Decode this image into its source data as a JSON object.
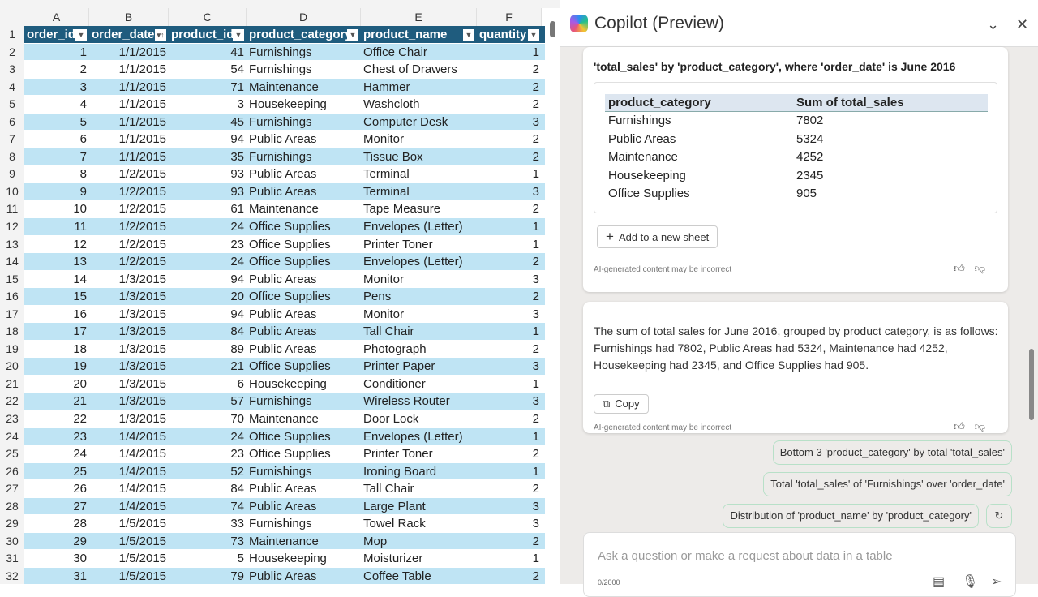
{
  "sheet": {
    "columns": [
      "A",
      "B",
      "C",
      "D",
      "E",
      "F"
    ],
    "headers": [
      "order_id",
      "order_date",
      "product_id",
      "product_category",
      "product_name",
      "quantity"
    ],
    "rows": [
      [
        1,
        "1/1/2015",
        41,
        "Furnishings",
        "Office Chair",
        1
      ],
      [
        2,
        "1/1/2015",
        54,
        "Furnishings",
        "Chest of Drawers",
        2
      ],
      [
        3,
        "1/1/2015",
        71,
        "Maintenance",
        "Hammer",
        2
      ],
      [
        4,
        "1/1/2015",
        3,
        "Housekeeping",
        "Washcloth",
        2
      ],
      [
        5,
        "1/1/2015",
        45,
        "Furnishings",
        "Computer Desk",
        3
      ],
      [
        6,
        "1/1/2015",
        94,
        "Public Areas",
        "Monitor",
        2
      ],
      [
        7,
        "1/1/2015",
        35,
        "Furnishings",
        "Tissue Box",
        2
      ],
      [
        8,
        "1/2/2015",
        93,
        "Public Areas",
        "Terminal",
        1
      ],
      [
        9,
        "1/2/2015",
        93,
        "Public Areas",
        "Terminal",
        3
      ],
      [
        10,
        "1/2/2015",
        61,
        "Maintenance",
        "Tape Measure",
        2
      ],
      [
        11,
        "1/2/2015",
        24,
        "Office Supplies",
        "Envelopes (Letter)",
        1
      ],
      [
        12,
        "1/2/2015",
        23,
        "Office Supplies",
        "Printer Toner",
        1
      ],
      [
        13,
        "1/2/2015",
        24,
        "Office Supplies",
        "Envelopes (Letter)",
        2
      ],
      [
        14,
        "1/3/2015",
        94,
        "Public Areas",
        "Monitor",
        3
      ],
      [
        15,
        "1/3/2015",
        20,
        "Office Supplies",
        "Pens",
        2
      ],
      [
        16,
        "1/3/2015",
        94,
        "Public Areas",
        "Monitor",
        3
      ],
      [
        17,
        "1/3/2015",
        84,
        "Public Areas",
        "Tall Chair",
        1
      ],
      [
        18,
        "1/3/2015",
        89,
        "Public Areas",
        "Photograph",
        2
      ],
      [
        19,
        "1/3/2015",
        21,
        "Office Supplies",
        "Printer Paper",
        3
      ],
      [
        20,
        "1/3/2015",
        6,
        "Housekeeping",
        "Conditioner",
        1
      ],
      [
        21,
        "1/3/2015",
        57,
        "Furnishings",
        "Wireless Router",
        3
      ],
      [
        22,
        "1/3/2015",
        70,
        "Maintenance",
        "Door Lock",
        2
      ],
      [
        23,
        "1/4/2015",
        24,
        "Office Supplies",
        "Envelopes (Letter)",
        1
      ],
      [
        24,
        "1/4/2015",
        23,
        "Office Supplies",
        "Printer Toner",
        2
      ],
      [
        25,
        "1/4/2015",
        52,
        "Furnishings",
        "Ironing Board",
        1
      ],
      [
        26,
        "1/4/2015",
        84,
        "Public Areas",
        "Tall Chair",
        2
      ],
      [
        27,
        "1/4/2015",
        74,
        "Public Areas",
        "Large Plant",
        3
      ],
      [
        28,
        "1/5/2015",
        33,
        "Furnishings",
        "Towel Rack",
        3
      ],
      [
        29,
        "1/5/2015",
        73,
        "Maintenance",
        "Mop",
        2
      ],
      [
        30,
        "1/5/2015",
        5,
        "Housekeeping",
        "Moisturizer",
        1
      ],
      [
        31,
        "1/5/2015",
        79,
        "Public Areas",
        "Coffee Table",
        2
      ]
    ]
  },
  "copilot": {
    "title": "Copilot (Preview)",
    "card1": {
      "title": "'total_sales' by 'product_category', where 'order_date' is June 2016",
      "table_headers": [
        "product_category",
        "Sum of total_sales"
      ],
      "table_rows": [
        [
          "Furnishings",
          "7802"
        ],
        [
          "Public Areas",
          "5324"
        ],
        [
          "Maintenance",
          "4252"
        ],
        [
          "Housekeeping",
          "2345"
        ],
        [
          "Office Supplies",
          "905"
        ]
      ],
      "add_button": "Add to a new sheet",
      "disclaimer": "AI-generated content may be incorrect"
    },
    "card2": {
      "text": "The sum of total sales for June 2016, grouped by product category, is as follows: Furnishings had 7802, Public Areas had 5324, Maintenance had 4252, Housekeeping had 2345, and Office Supplies had 905.",
      "copy_button": "Copy",
      "disclaimer": "AI-generated content may be incorrect"
    },
    "suggestions": [
      "Bottom 3 'product_category' by total 'total_sales'",
      "Total 'total_sales' of 'Furnishings' over 'order_date'",
      "Distribution of 'product_name' by 'product_category'"
    ],
    "input_placeholder": "Ask a question or make a request about data in a table",
    "char_count": "0/2000"
  }
}
